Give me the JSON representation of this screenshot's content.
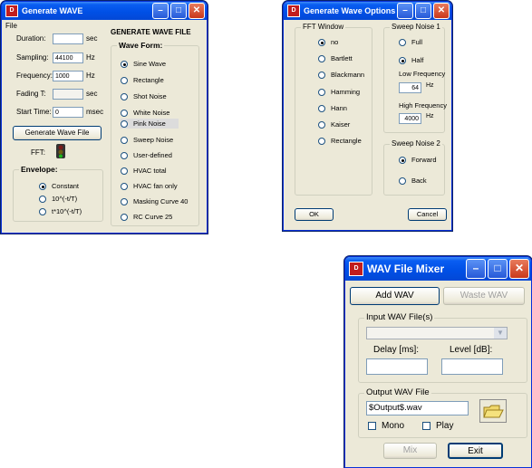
{
  "gen": {
    "title": "Generate WAVE",
    "menu_file": "File",
    "duration_label": "Duration:",
    "duration_value": "",
    "duration_unit": "sec",
    "sampling_label": "Sampling:",
    "sampling_value": "44100",
    "sampling_unit": "Hz",
    "frequency_label": "Frequency:",
    "frequency_value": "1000",
    "frequency_unit": "Hz",
    "fading_label": "Fading T:",
    "fading_value": "",
    "fading_unit": "sec",
    "start_label": "Start Time:",
    "start_value": "0",
    "start_unit": "msec",
    "generate_button": "Generate Wave File",
    "fft_label": "FFT:",
    "heading": "GENERATE WAVE FILE",
    "waveform_title": "Wave Form:",
    "waveforms": [
      "Sine Wave",
      "Rectangle",
      "Shot Noise",
      "White Noise",
      "Pink Noise",
      "Sweep Noise",
      "User-defined",
      "HVAC total",
      "HVAC fan only",
      "Masking Curve 40",
      "RC Curve 25"
    ],
    "envelope_title": "Envelope:",
    "envelopes": [
      "Constant",
      "10^(-t/T)",
      "t*10^(-t/T)"
    ]
  },
  "opt": {
    "title": "Generate Wave Options",
    "fft_window_title": "FFT Window",
    "fft_windows": [
      "no",
      "Bartlett",
      "Blackmann",
      "Hamming",
      "Hann",
      "Kaiser",
      "Rectangle"
    ],
    "sweep1_title": "Sweep Noise 1",
    "sweep1_options": [
      "Full",
      "Half"
    ],
    "low_freq_label": "Low Frequency",
    "low_freq_value": "64",
    "low_freq_unit": "Hz",
    "high_freq_label": "High Frequency",
    "high_freq_value": "4000",
    "high_freq_unit": "Hz",
    "sweep2_title": "Sweep Noise 2",
    "sweep2_options": [
      "Forward",
      "Back"
    ],
    "ok_button": "OK",
    "cancel_button": "Cancel"
  },
  "mix": {
    "title": "WAV File Mixer",
    "add_button": "Add WAV",
    "waste_button": "Waste WAV",
    "input_title": "Input WAV File(s)",
    "delay_label": "Delay [ms]:",
    "level_label": "Level [dB]:",
    "output_title": "Output WAV File",
    "output_value": "$Output$.wav",
    "mono_label": "Mono",
    "play_label": "Play",
    "mix_button": "Mix",
    "exit_button": "Exit"
  }
}
